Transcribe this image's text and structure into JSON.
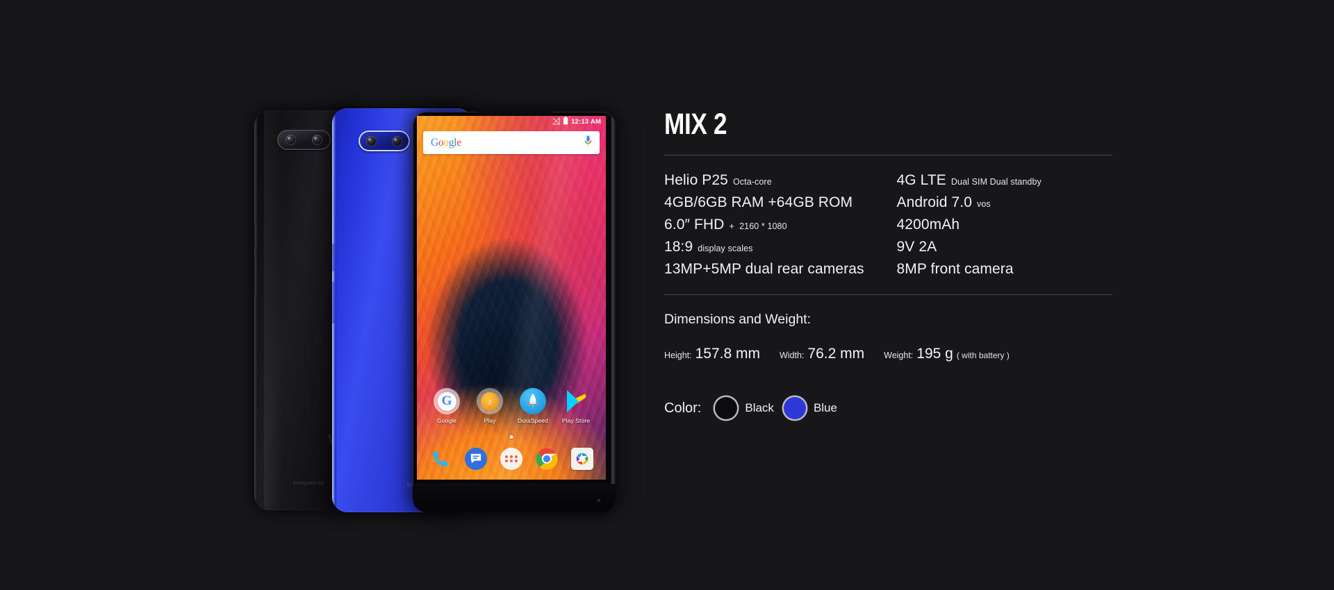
{
  "page": {
    "background_color": "#17171a",
    "title": "MIX 2"
  },
  "product": {
    "name": "MIX 2",
    "specs_left": [
      {
        "main": "Helio P25",
        "sub": "Octa-core"
      },
      {
        "main": "4GB/6GB RAM +64GB ROM",
        "sub": ""
      },
      {
        "main": "6.0″  FHD",
        "sup": "+",
        "sub": "2160 * 1080"
      },
      {
        "main": "18:9",
        "sub": "display scales"
      },
      {
        "main": "13MP+5MP dual rear cameras",
        "sub": ""
      }
    ],
    "specs_right": [
      {
        "main": "4G LTE",
        "sub": "Dual SIM Dual standby"
      },
      {
        "main": "Android 7.0",
        "sub": "vos"
      },
      {
        "main": "4200mAh",
        "sub": ""
      },
      {
        "main": "9V 2A",
        "sub": ""
      },
      {
        "main": "8MP front camera",
        "sub": ""
      }
    ],
    "dimensions": {
      "section_title": "Dimensions and Weight:",
      "height_label": "Height:",
      "height_value": "157.8 mm",
      "width_label": "Width:",
      "width_value": "76.2 mm",
      "weight_label": "Weight:",
      "weight_value": "195 g",
      "weight_note": "( with battery )"
    },
    "color": {
      "label": "Color:",
      "options": [
        {
          "name": "Black",
          "hex": "#0c0c0e"
        },
        {
          "name": "Blue",
          "hex": "#2c39d6"
        }
      ]
    }
  },
  "phone_screen": {
    "status_bar": {
      "time": "12:13 AM",
      "icons": [
        "signal-off-icon",
        "battery-icon"
      ]
    },
    "search": {
      "logo_letters": [
        "G",
        "o",
        "o",
        "g",
        "l",
        "e"
      ],
      "mic_icon": "microphone-icon"
    },
    "apps": [
      {
        "label": "Google",
        "icon": "google-icon"
      },
      {
        "label": "Play",
        "icon": "play-music-icon"
      },
      {
        "label": "DuraSpeed",
        "icon": "rocket-icon"
      },
      {
        "label": "Play Store",
        "icon": "play-store-icon"
      }
    ],
    "dock": [
      {
        "icon": "phone-icon"
      },
      {
        "icon": "messages-icon"
      },
      {
        "icon": "app-drawer-icon"
      },
      {
        "icon": "chrome-icon"
      },
      {
        "icon": "camera-icon"
      }
    ],
    "nav_bar": [
      {
        "icon": "recents-square-icon"
      },
      {
        "icon": "home-circle-icon"
      },
      {
        "icon": "back-triangle-icon"
      }
    ]
  },
  "phone_backs": {
    "logo": "V",
    "designed_by": "Designed by"
  }
}
